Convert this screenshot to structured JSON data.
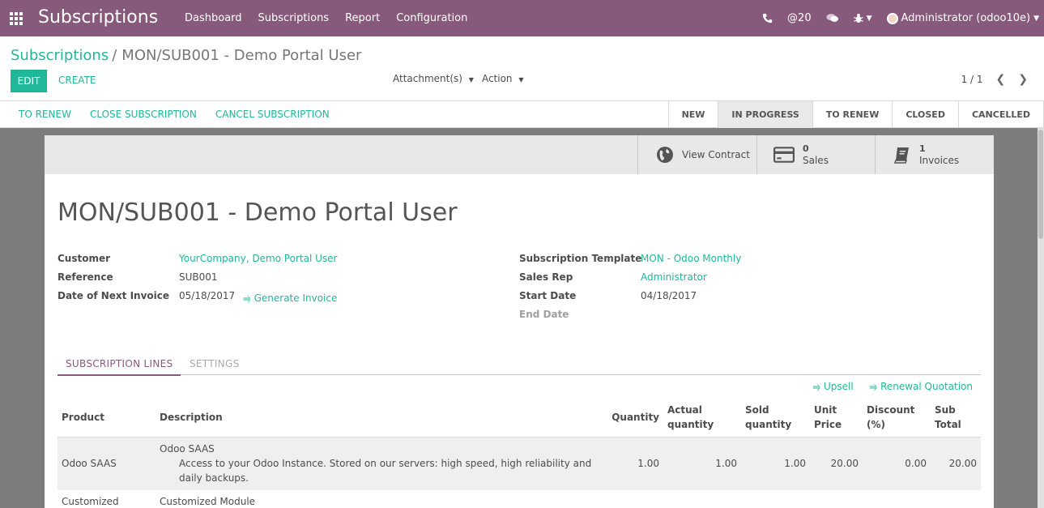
{
  "navbar": {
    "brand": "Subscriptions",
    "menu": [
      "Dashboard",
      "Subscriptions",
      "Report",
      "Configuration"
    ],
    "phone_icon": "phone-icon",
    "mentions_count": "@20",
    "chat_icon": "chat-bubbles-icon",
    "debug_icon": "bug-icon",
    "user": "Administrator (odoo10e)",
    "accent_color": "#875a7b"
  },
  "control_panel": {
    "breadcrumb_root": "Subscriptions",
    "breadcrumb_current": "MON/SUB001 - Demo Portal User",
    "edit_label": "EDIT",
    "create_label": "CREATE",
    "attachments_label": "Attachment(s)",
    "action_label": "Action",
    "pager": "1 / 1"
  },
  "statusbar": {
    "buttons": [
      "TO RENEW",
      "CLOSE SUBSCRIPTION",
      "CANCEL SUBSCRIPTION"
    ],
    "states": [
      "NEW",
      "IN PROGRESS",
      "TO RENEW",
      "CLOSED",
      "CANCELLED"
    ],
    "active_state": "IN PROGRESS"
  },
  "smart_buttons": {
    "view_contract": "View Contract",
    "sales_count": "0",
    "sales_label": "Sales",
    "invoices_count": "1",
    "invoices_label": "Invoices"
  },
  "record": {
    "title": "MON/SUB001 - Demo Portal User",
    "left": {
      "customer_label": "Customer",
      "customer": "YourCompany, Demo Portal User",
      "reference_label": "Reference",
      "reference": "SUB001",
      "next_invoice_label": "Date of Next Invoice",
      "next_invoice": "05/18/2017",
      "generate_invoice": "⥤ Generate Invoice"
    },
    "right": {
      "template_label": "Subscription Template",
      "template": "MON - Odoo Monthly",
      "sales_rep_label": "Sales Rep",
      "sales_rep": "Administrator",
      "start_date_label": "Start Date",
      "start_date": "04/18/2017",
      "end_date_label": "End Date"
    }
  },
  "tabs": {
    "lines": "SUBSCRIPTION LINES",
    "settings": "SETTINGS"
  },
  "line_actions": {
    "upsell": "⥤ Upsell",
    "renewal": "⥤ Renewal Quotation"
  },
  "lines_table": {
    "headers": [
      "Product",
      "Description",
      "Quantity",
      "Actual quantity",
      "Sold quantity",
      "Unit Price",
      "Discount (%)",
      "Sub Total"
    ],
    "rows": [
      {
        "product": "Odoo SAAS",
        "desc_title": "Odoo SAAS",
        "desc_body": "Access to your Odoo Instance. Stored on our servers: high speed, high reliability and daily backups.",
        "quantity": "1.00",
        "actual": "1.00",
        "sold": "1.00",
        "unit_price": "20.00",
        "discount": "0.00",
        "subtotal": "20.00"
      },
      {
        "product": "Customized",
        "desc_title": "Customized Module"
      }
    ]
  }
}
